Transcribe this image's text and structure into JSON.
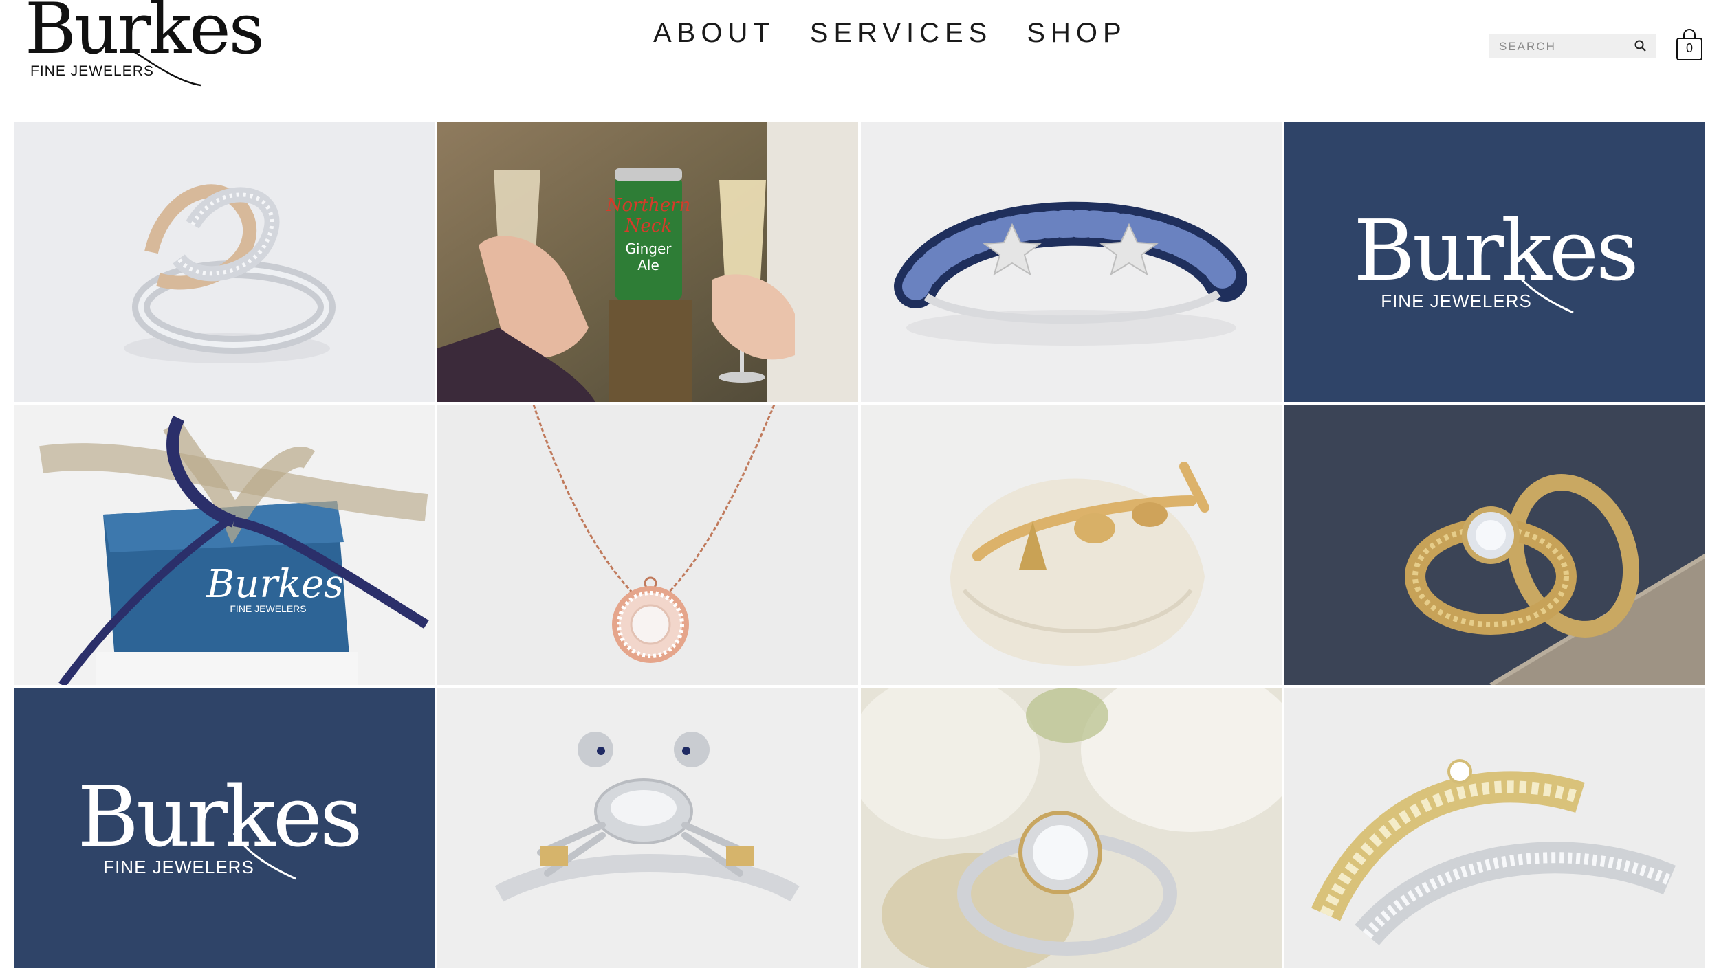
{
  "brand": {
    "name": "Burkes",
    "tagline": "FINE JEWELERS"
  },
  "nav": {
    "items": [
      "ABOUT",
      "SERVICES",
      "SHOP"
    ]
  },
  "search": {
    "placeholder": "SEARCH"
  },
  "cart": {
    "count": "0"
  },
  "colors": {
    "navy": "#2f4468",
    "text": "#111111",
    "search_bg": "#efefef"
  },
  "grid": {
    "tiles": [
      {
        "subject": "two-tone twisted knot ring with diamonds"
      },
      {
        "subject": "hands holding champagne flutes beside a can of Northern Neck Ginger Ale",
        "can_text": [
          "Northern",
          "Neck",
          "Ginger",
          "Ale"
        ]
      },
      {
        "subject": "sapphire and diamond starfish bangle bracelet"
      },
      {
        "subject": "Burkes Fine Jewelers logo on navy",
        "logo_name": "Burkes",
        "logo_tagline": "FINE JEWELERS"
      },
      {
        "subject": "Burkes gift box tied with navy ribbon",
        "box_name": "Burkes",
        "box_tagline": "FINE JEWELERS"
      },
      {
        "subject": "rose gold halo diamond pendant necklace"
      },
      {
        "subject": "gold nautical charm bracelet on a seashell"
      },
      {
        "subject": "gold rope engagement ring and wedding bands on burlap"
      },
      {
        "subject": "Burkes Fine Jewelers logo on navy",
        "logo_name": "Burkes",
        "logo_tagline": "FINE JEWELERS"
      },
      {
        "subject": "two-tone crab ring"
      },
      {
        "subject": "diamond halo engagement ring among white flowers"
      },
      {
        "subject": "stacked yellow and white diamond bands"
      }
    ]
  }
}
